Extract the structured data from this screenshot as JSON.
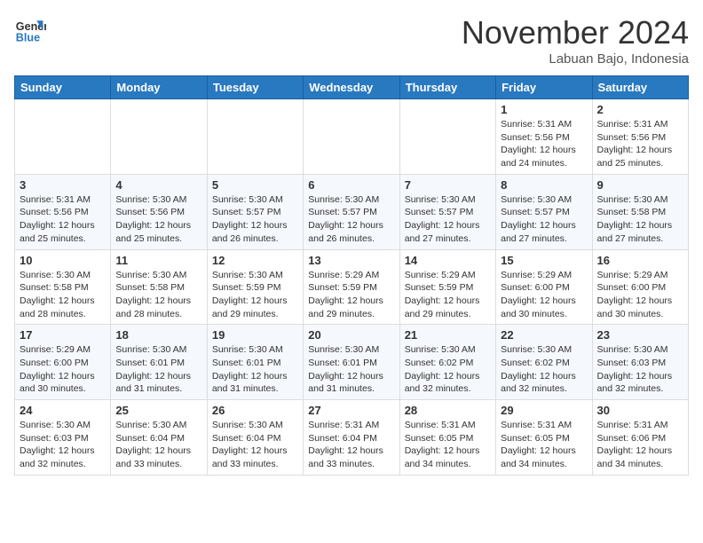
{
  "header": {
    "logo_line1": "General",
    "logo_line2": "Blue",
    "month_title": "November 2024",
    "location": "Labuan Bajo, Indonesia"
  },
  "weekdays": [
    "Sunday",
    "Monday",
    "Tuesday",
    "Wednesday",
    "Thursday",
    "Friday",
    "Saturday"
  ],
  "weeks": [
    [
      {
        "day": "",
        "info": ""
      },
      {
        "day": "",
        "info": ""
      },
      {
        "day": "",
        "info": ""
      },
      {
        "day": "",
        "info": ""
      },
      {
        "day": "",
        "info": ""
      },
      {
        "day": "1",
        "info": "Sunrise: 5:31 AM\nSunset: 5:56 PM\nDaylight: 12 hours\nand 24 minutes."
      },
      {
        "day": "2",
        "info": "Sunrise: 5:31 AM\nSunset: 5:56 PM\nDaylight: 12 hours\nand 25 minutes."
      }
    ],
    [
      {
        "day": "3",
        "info": "Sunrise: 5:31 AM\nSunset: 5:56 PM\nDaylight: 12 hours\nand 25 minutes."
      },
      {
        "day": "4",
        "info": "Sunrise: 5:30 AM\nSunset: 5:56 PM\nDaylight: 12 hours\nand 25 minutes."
      },
      {
        "day": "5",
        "info": "Sunrise: 5:30 AM\nSunset: 5:57 PM\nDaylight: 12 hours\nand 26 minutes."
      },
      {
        "day": "6",
        "info": "Sunrise: 5:30 AM\nSunset: 5:57 PM\nDaylight: 12 hours\nand 26 minutes."
      },
      {
        "day": "7",
        "info": "Sunrise: 5:30 AM\nSunset: 5:57 PM\nDaylight: 12 hours\nand 27 minutes."
      },
      {
        "day": "8",
        "info": "Sunrise: 5:30 AM\nSunset: 5:57 PM\nDaylight: 12 hours\nand 27 minutes."
      },
      {
        "day": "9",
        "info": "Sunrise: 5:30 AM\nSunset: 5:58 PM\nDaylight: 12 hours\nand 27 minutes."
      }
    ],
    [
      {
        "day": "10",
        "info": "Sunrise: 5:30 AM\nSunset: 5:58 PM\nDaylight: 12 hours\nand 28 minutes."
      },
      {
        "day": "11",
        "info": "Sunrise: 5:30 AM\nSunset: 5:58 PM\nDaylight: 12 hours\nand 28 minutes."
      },
      {
        "day": "12",
        "info": "Sunrise: 5:30 AM\nSunset: 5:59 PM\nDaylight: 12 hours\nand 29 minutes."
      },
      {
        "day": "13",
        "info": "Sunrise: 5:29 AM\nSunset: 5:59 PM\nDaylight: 12 hours\nand 29 minutes."
      },
      {
        "day": "14",
        "info": "Sunrise: 5:29 AM\nSunset: 5:59 PM\nDaylight: 12 hours\nand 29 minutes."
      },
      {
        "day": "15",
        "info": "Sunrise: 5:29 AM\nSunset: 6:00 PM\nDaylight: 12 hours\nand 30 minutes."
      },
      {
        "day": "16",
        "info": "Sunrise: 5:29 AM\nSunset: 6:00 PM\nDaylight: 12 hours\nand 30 minutes."
      }
    ],
    [
      {
        "day": "17",
        "info": "Sunrise: 5:29 AM\nSunset: 6:00 PM\nDaylight: 12 hours\nand 30 minutes."
      },
      {
        "day": "18",
        "info": "Sunrise: 5:30 AM\nSunset: 6:01 PM\nDaylight: 12 hours\nand 31 minutes."
      },
      {
        "day": "19",
        "info": "Sunrise: 5:30 AM\nSunset: 6:01 PM\nDaylight: 12 hours\nand 31 minutes."
      },
      {
        "day": "20",
        "info": "Sunrise: 5:30 AM\nSunset: 6:01 PM\nDaylight: 12 hours\nand 31 minutes."
      },
      {
        "day": "21",
        "info": "Sunrise: 5:30 AM\nSunset: 6:02 PM\nDaylight: 12 hours\nand 32 minutes."
      },
      {
        "day": "22",
        "info": "Sunrise: 5:30 AM\nSunset: 6:02 PM\nDaylight: 12 hours\nand 32 minutes."
      },
      {
        "day": "23",
        "info": "Sunrise: 5:30 AM\nSunset: 6:03 PM\nDaylight: 12 hours\nand 32 minutes."
      }
    ],
    [
      {
        "day": "24",
        "info": "Sunrise: 5:30 AM\nSunset: 6:03 PM\nDaylight: 12 hours\nand 32 minutes."
      },
      {
        "day": "25",
        "info": "Sunrise: 5:30 AM\nSunset: 6:04 PM\nDaylight: 12 hours\nand 33 minutes."
      },
      {
        "day": "26",
        "info": "Sunrise: 5:30 AM\nSunset: 6:04 PM\nDaylight: 12 hours\nand 33 minutes."
      },
      {
        "day": "27",
        "info": "Sunrise: 5:31 AM\nSunset: 6:04 PM\nDaylight: 12 hours\nand 33 minutes."
      },
      {
        "day": "28",
        "info": "Sunrise: 5:31 AM\nSunset: 6:05 PM\nDaylight: 12 hours\nand 34 minutes."
      },
      {
        "day": "29",
        "info": "Sunrise: 5:31 AM\nSunset: 6:05 PM\nDaylight: 12 hours\nand 34 minutes."
      },
      {
        "day": "30",
        "info": "Sunrise: 5:31 AM\nSunset: 6:06 PM\nDaylight: 12 hours\nand 34 minutes."
      }
    ]
  ]
}
